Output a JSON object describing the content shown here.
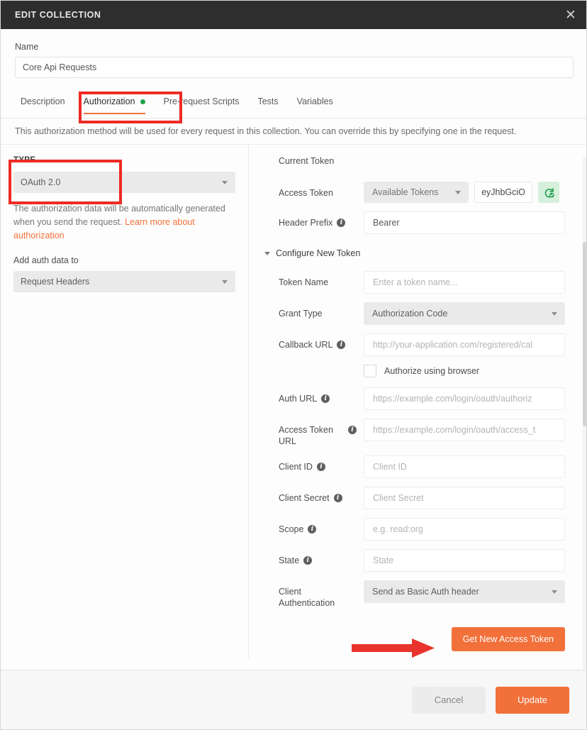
{
  "window": {
    "title": "EDIT COLLECTION",
    "close_icon": "close-icon"
  },
  "name_section": {
    "label": "Name",
    "value": "Core Api Requests"
  },
  "tabs": [
    {
      "label": "Description",
      "active": false,
      "dot": false
    },
    {
      "label": "Authorization",
      "active": true,
      "dot": true
    },
    {
      "label": "Pre-request Scripts",
      "active": false,
      "dot": false
    },
    {
      "label": "Tests",
      "active": false,
      "dot": false
    },
    {
      "label": "Variables",
      "active": false,
      "dot": false
    }
  ],
  "description_bar": {
    "text": "This authorization method will be used for every request in this collection. You can override this by specifying one in the request."
  },
  "left_panel": {
    "type_label": "TYPE",
    "type_value": "OAuth 2.0",
    "help_text_before": "The authorization data will be automatically generated when you send the request. ",
    "help_link": "Learn more about authorization",
    "add_auth_label": "Add auth data to",
    "add_auth_value": "Request Headers"
  },
  "right_panel": {
    "current_token_title": "Current Token",
    "access_token_label": "Access Token",
    "access_token_select": "Available Tokens",
    "access_token_value": "eyJhbGciO",
    "refresh_icon": "refresh-token-icon",
    "header_prefix_label": "Header Prefix",
    "header_prefix_value": "Bearer",
    "configure_title": "Configure New Token",
    "fields": [
      {
        "label": "Token Name",
        "info": false,
        "type": "input",
        "value": "",
        "placeholder": "Enter a token name..."
      },
      {
        "label": "Grant Type",
        "info": false,
        "type": "select",
        "value": "Authorization Code",
        "placeholder": ""
      },
      {
        "label": "Callback URL",
        "info": true,
        "type": "input",
        "value": "",
        "placeholder": "http://your-application.com/registered/cal"
      },
      {
        "label": "Auth URL",
        "info": true,
        "type": "input",
        "value": "",
        "placeholder": "https://example.com/login/oauth/authoriz"
      },
      {
        "label": "Access Token URL",
        "info": true,
        "type": "input",
        "value": "",
        "placeholder": "https://example.com/login/oauth/access_t"
      },
      {
        "label": "Client ID",
        "info": true,
        "type": "input",
        "value": "",
        "placeholder": "Client ID"
      },
      {
        "label": "Client Secret",
        "info": true,
        "type": "input",
        "value": "",
        "placeholder": "Client Secret"
      },
      {
        "label": "Scope",
        "info": true,
        "type": "input",
        "value": "",
        "placeholder": "e.g. read:org"
      },
      {
        "label": "State",
        "info": true,
        "type": "input",
        "value": "",
        "placeholder": "State"
      },
      {
        "label": "Client Authentication",
        "info": false,
        "type": "select",
        "value": "Send as Basic Auth header",
        "placeholder": ""
      }
    ],
    "authorize_browser_label": "Authorize using browser",
    "authorize_browser_checked": false,
    "get_token_button": "Get New Access Token"
  },
  "footer": {
    "cancel": "Cancel",
    "update": "Update"
  },
  "colors": {
    "accent_orange": "#f2703a",
    "annotation_red": "#ee2b24",
    "status_green": "#1aa34a",
    "titlebar_dark": "#2e2e2e"
  }
}
